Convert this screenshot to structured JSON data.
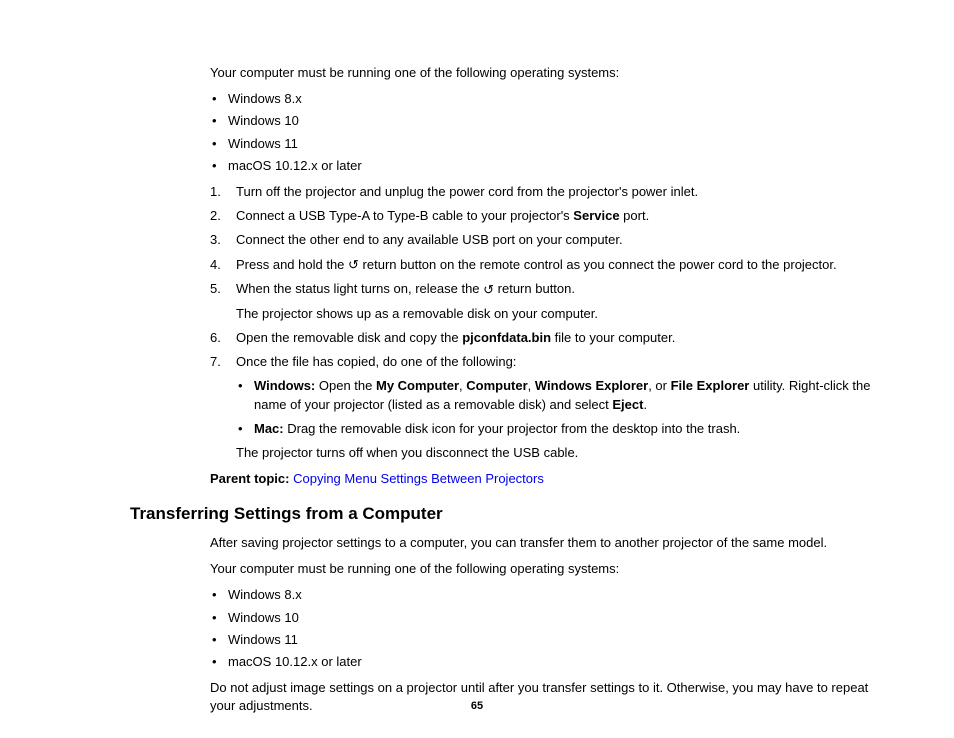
{
  "intro_line": "Your computer must be running one of the following operating systems:",
  "os_list": [
    "Windows 8.x",
    "Windows 10",
    "Windows 11",
    "macOS 10.12.x or later"
  ],
  "steps": {
    "s1": "Turn off the projector and unplug the power cord from the projector's power inlet.",
    "s2_a": "Connect a USB Type-A to Type-B cable to your projector's ",
    "s2_b": "Service",
    "s2_c": " port.",
    "s3": "Connect the other end to any available USB port on your computer.",
    "s4_a": "Press and hold the ",
    "s4_b": " return button on the remote control as you connect the power cord to the projector.",
    "s5_a": "When the status light turns on, release the ",
    "s5_b": " return button.",
    "s5_p": "The projector shows up as a removable disk on your computer.",
    "s6_a": "Open the removable disk and copy the ",
    "s6_b": "pjconfdata.bin",
    "s6_c": " file to your computer.",
    "s7": "Once the file has copied, do one of the following:",
    "s7_win_a": "Windows:",
    "s7_win_b": " Open the ",
    "s7_win_c": "My Computer",
    "s7_win_d": ", ",
    "s7_win_e": "Computer",
    "s7_win_f": ", ",
    "s7_win_g": "Windows Explorer",
    "s7_win_h": ", or ",
    "s7_win_i": "File Explorer",
    "s7_win_j": " utility. Right-click the name of your projector (listed as a removable disk) and select ",
    "s7_win_k": "Eject",
    "s7_win_l": ".",
    "s7_mac_a": "Mac:",
    "s7_mac_b": " Drag the removable disk icon for your projector from the desktop into the trash.",
    "s7_p": "The projector turns off when you disconnect the USB cable."
  },
  "parent_topic_label": "Parent topic:",
  "parent_topic_link": "Copying Menu Settings Between Projectors",
  "section2": {
    "heading": "Transferring Settings from a Computer",
    "p1": "After saving projector settings to a computer, you can transfer them to another projector of the same model.",
    "p2": "Your computer must be running one of the following operating systems:",
    "os_list": [
      "Windows 8.x",
      "Windows 10",
      "Windows 11",
      "macOS 10.12.x or later"
    ],
    "p3": "Do not adjust image settings on a projector until after you transfer settings to it. Otherwise, you may have to repeat your adjustments."
  },
  "return_icon": "↺",
  "page_number": "65"
}
